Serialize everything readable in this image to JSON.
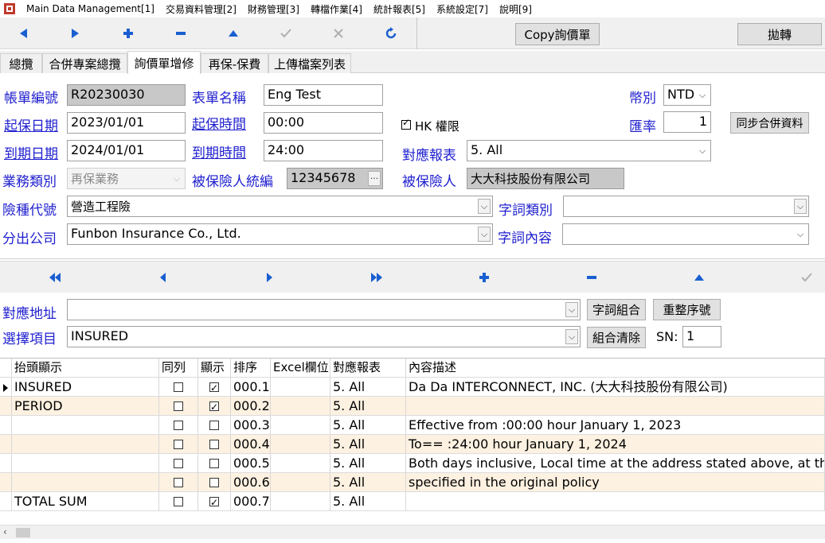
{
  "menu": {
    "items": [
      "Main Data Management[1]",
      "交易資料管理[2]",
      "財務管理[3]",
      "轉檔作業[4]",
      "統計報表[5]",
      "系統設定[7]",
      "說明[9]"
    ]
  },
  "toolbar": {
    "copy_label": "Copy詢價單",
    "transfer_label": "拋轉"
  },
  "tabs": [
    "總攬",
    "合併專案總攬",
    "詢價單增修",
    "再保-保費",
    "上傳檔案列表"
  ],
  "form": {
    "account_no_label": "帳單編號",
    "account_no": "R20230030",
    "form_name_label": "表單名稱",
    "form_name": "Eng Test",
    "currency_label": "幣別",
    "currency": "NTD",
    "start_date_label": "起保日期",
    "start_date": "2023/01/01",
    "start_time_label": "起保時間",
    "start_time": "00:00",
    "hk_label": "HK 權限",
    "rate_label": "匯率",
    "rate": "1",
    "sync_label": "同步合併資料",
    "end_date_label": "到期日期",
    "end_date": "2024/01/01",
    "end_time_label": "到期時間",
    "end_time": "24:00",
    "report_label": "對應報表",
    "report": "5. All",
    "biz_type_label": "業務類別",
    "biz_type": "再保業務",
    "insured_id_label": "被保險人統編",
    "insured_id": "12345678",
    "insured_label": "被保險人",
    "insured": "大大科技股份有限公司",
    "risk_code_label": "險種代號",
    "risk_code": "營造工程險",
    "word_type_label": "字詞類別",
    "word_type": "",
    "cedant_label": "分出公司",
    "cedant": "Funbon Insurance Co., Ltd.",
    "word_content_label": "字詞內容",
    "word_content": ""
  },
  "detail": {
    "address_label": "對應地址",
    "address": "",
    "word_combine_label": "字詞組合",
    "renumber_label": "重整序號",
    "select_label": "選擇項目",
    "select": "INSURED",
    "clear_label": "組合清除",
    "sn_label": "SN:",
    "sn": "1"
  },
  "grid": {
    "headers": [
      "抬頭顯示",
      "同列",
      "顯示",
      "排序",
      "Excel欄位",
      "對應報表",
      "內容描述"
    ],
    "rows": [
      {
        "title": "INSURED",
        "same_row": false,
        "show": true,
        "order": "000.1",
        "excel": "",
        "report": "5. All",
        "desc": "Da Da INTERCONNECT, INC. (大大科技股份有限公司)"
      },
      {
        "title": "PERIOD",
        "same_row": false,
        "show": true,
        "order": "000.2",
        "excel": "",
        "report": "5. All",
        "desc": ""
      },
      {
        "title": "",
        "same_row": false,
        "show": false,
        "order": "000.3",
        "excel": "",
        "report": "5. All",
        "desc": "Effective from :00:00 hour January 1, 2023"
      },
      {
        "title": "",
        "same_row": false,
        "show": false,
        "order": "000.4",
        "excel": "",
        "report": "5. All",
        "desc": "To== :24:00 hour January 1, 2024"
      },
      {
        "title": "",
        "same_row": false,
        "show": false,
        "order": "000.5",
        "excel": "",
        "report": "5. All",
        "desc": "Both days inclusive, Local time at the address stated above, at the time"
      },
      {
        "title": "",
        "same_row": false,
        "show": false,
        "order": "000.6",
        "excel": "",
        "report": "5. All",
        "desc": "specified in the original policy"
      },
      {
        "title": "TOTAL SUM",
        "same_row": false,
        "show": true,
        "order": "000.7",
        "excel": "",
        "report": "5. All",
        "desc": ""
      }
    ]
  },
  "colors": {
    "label_blue": "#1f1fcf",
    "icon_blue": "#1a5fd1",
    "row_alt": "#fdf1e1"
  }
}
